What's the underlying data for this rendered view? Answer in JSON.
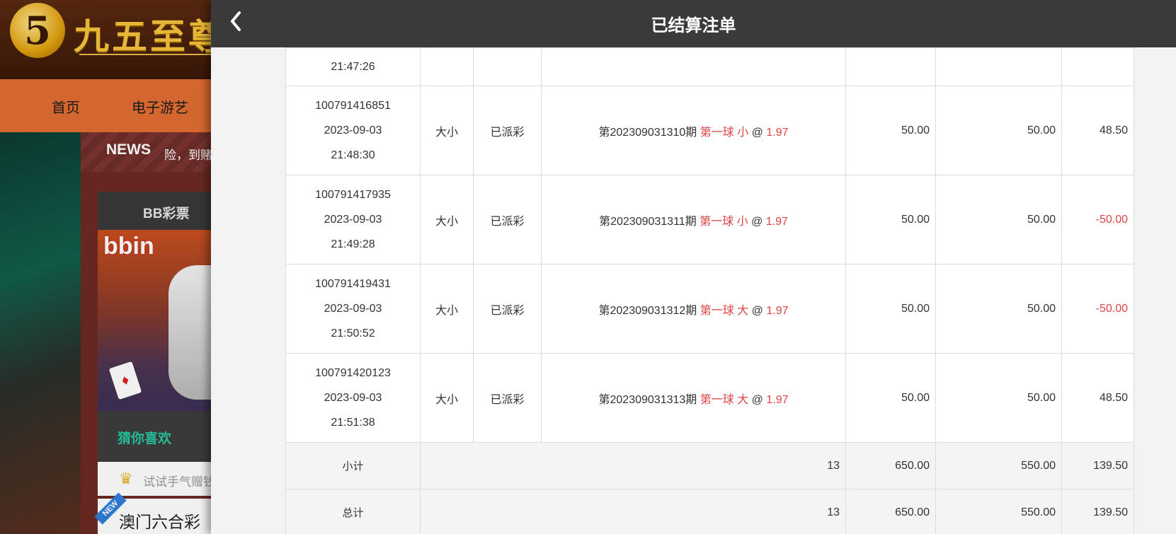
{
  "site": {
    "logo_glyph": "5",
    "logo_text": "九五至尊",
    "nav": [
      "首页",
      "电子游艺"
    ],
    "news_label": "NEWS",
    "news_text": "险，到赌",
    "panel_tab": "BB彩票",
    "bbin_logo": "bbin",
    "guess_tab": "猜你喜欢",
    "try_text": "试试手气赠钱",
    "new_badge": "NEW",
    "macau_text": "澳门六合彩"
  },
  "modal": {
    "title": "已结算注单",
    "back_icon": "chevron-left-icon"
  },
  "table": {
    "top_row": {
      "time": "21:47:26"
    },
    "rows": [
      {
        "id": "100791416851",
        "date": "2023-09-03",
        "time": "21:48:30",
        "game": "大小",
        "status": "已派彩",
        "period": "第202309031310期",
        "pick": "第一球 小",
        "at": "@",
        "odds": "1.97",
        "amount": "50.00",
        "valid": "50.00",
        "win": "48.50",
        "win_negative": false
      },
      {
        "id": "100791417935",
        "date": "2023-09-03",
        "time": "21:49:28",
        "game": "大小",
        "status": "已派彩",
        "period": "第202309031311期",
        "pick": "第一球 小",
        "at": "@",
        "odds": "1.97",
        "amount": "50.00",
        "valid": "50.00",
        "win": "-50.00",
        "win_negative": true
      },
      {
        "id": "100791419431",
        "date": "2023-09-03",
        "time": "21:50:52",
        "game": "大小",
        "status": "已派彩",
        "period": "第202309031312期",
        "pick": "第一球 大",
        "at": "@",
        "odds": "1.97",
        "amount": "50.00",
        "valid": "50.00",
        "win": "-50.00",
        "win_negative": true
      },
      {
        "id": "100791420123",
        "date": "2023-09-03",
        "time": "21:51:38",
        "game": "大小",
        "status": "已派彩",
        "period": "第202309031313期",
        "pick": "第一球 大",
        "at": "@",
        "odds": "1.97",
        "amount": "50.00",
        "valid": "50.00",
        "win": "48.50",
        "win_negative": false
      }
    ],
    "subtotal": {
      "label": "小计",
      "count": "13",
      "amount": "650.00",
      "valid": "550.00",
      "win": "139.50"
    },
    "total": {
      "label": "总计",
      "count": "13",
      "amount": "650.00",
      "valid": "550.00",
      "win": "139.50"
    }
  },
  "colors": {
    "header_bg": "#3a3a3a",
    "accent_red": "#e04343",
    "nav_orange": "#e26d34"
  }
}
